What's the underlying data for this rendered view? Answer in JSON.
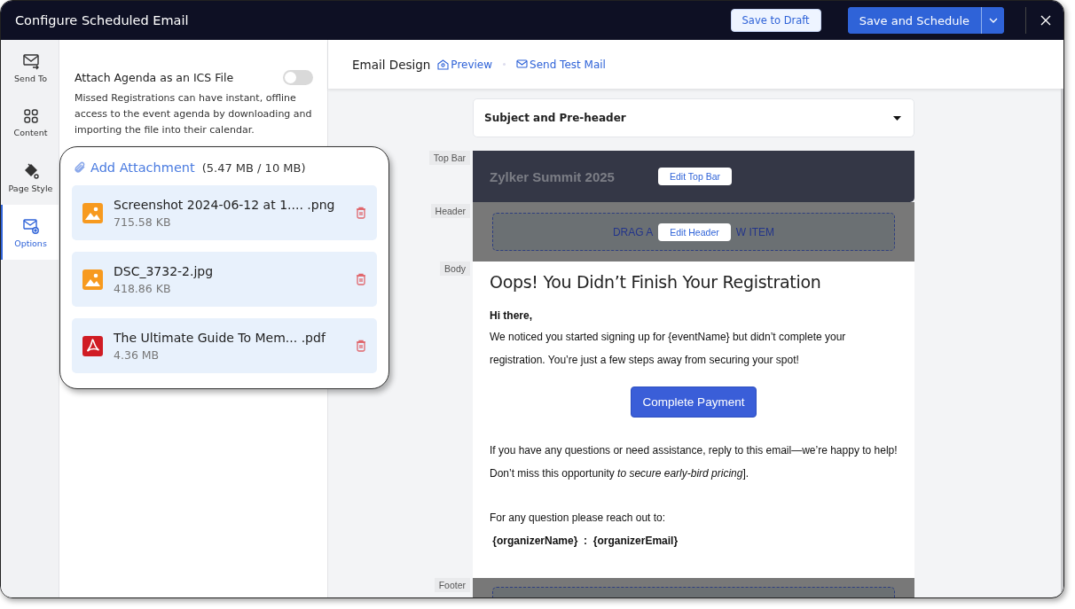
{
  "window": {
    "title": "Configure Scheduled Email"
  },
  "header_actions": {
    "draft": "Save to Draft",
    "primary": "Save and Schedule"
  },
  "nav": [
    {
      "label": "Send To",
      "selected": false
    },
    {
      "label": "Content",
      "selected": false
    },
    {
      "label": "Page Style",
      "selected": false
    },
    {
      "label": "Options",
      "selected": true
    }
  ],
  "options": {
    "title": "Attach Agenda as an ICS File",
    "on": false,
    "description": "Missed Registrations can have instant, offline access to the event agenda by downloading and importing the file into their calendar."
  },
  "attachments": {
    "action": "Add Attachment",
    "usage": "(5.47 MB / 10 MB)",
    "files": [
      {
        "kind": "image",
        "name": "Screenshot 2024-06-12 at 1....",
        "ext": ".png",
        "size": "715.58 KB"
      },
      {
        "kind": "image",
        "name": "DSC_3732-2.jpg",
        "size": "418.86 KB"
      },
      {
        "kind": "pdf",
        "name": "The Ultimate Guide To Mem...",
        "ext": ".pdf",
        "size": "4.36 MB"
      }
    ]
  },
  "design": {
    "title": "Email Design",
    "links": [
      "Preview",
      "Send Test Mail"
    ],
    "subject": "Subject and Pre-header"
  },
  "sections": {
    "top_bar": {
      "tag": "Top Bar",
      "title": "Zylker Summit 2025",
      "edit": "Edit Top Bar"
    },
    "header": {
      "tag": "Header",
      "placeholder_left": "DRAG A",
      "placeholder_right": "W ITEM",
      "edit": "Edit Header"
    },
    "body": {
      "tag": "Body",
      "heading": "Oops! You Didn’t Finish Your Registration",
      "greeting": "Hi there,",
      "paragraph": "We noticed you started signing up for {eventName}  but didn’t complete your registration. You’re just a few steps away from securing your spot!",
      "button": "Complete Payment",
      "closing_1": "If you have any questions or need assistance, reply to this email—we’re happy to help!",
      "closing_2": "Don’t miss this opportunity *to secure early-bird pricing*].",
      "contact_intro": "For any question please reach out to:",
      "contact": "{organizerName}  :  {organizerEmail}"
    },
    "footer": {
      "tag": "Footer"
    }
  }
}
